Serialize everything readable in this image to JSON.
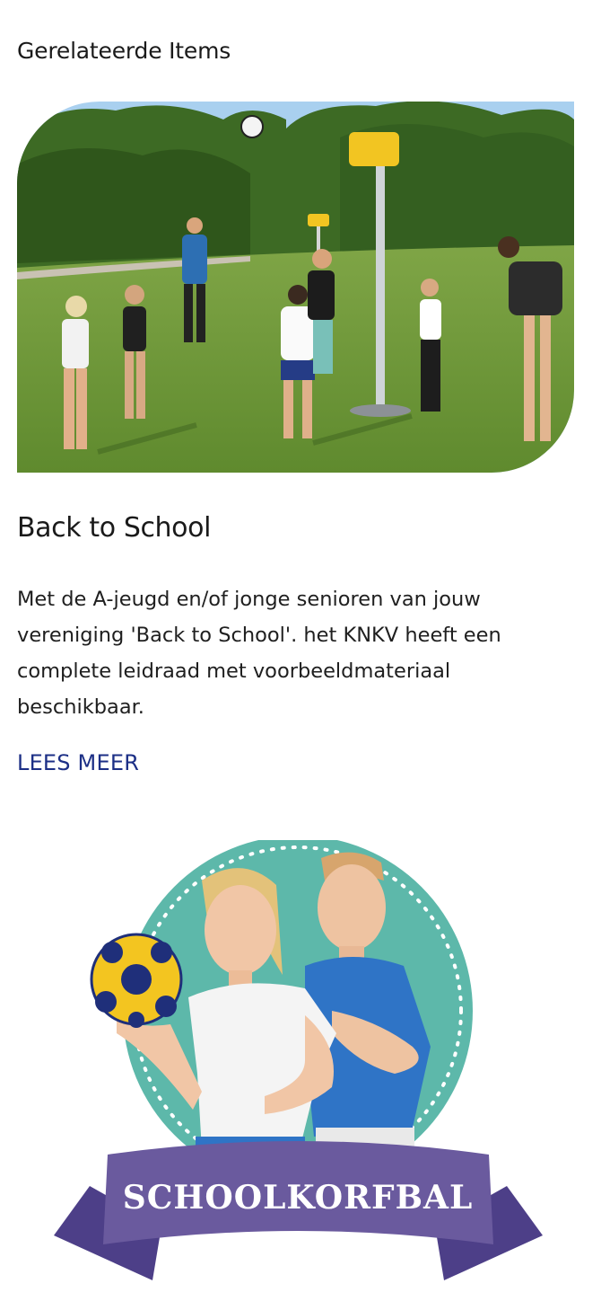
{
  "section": {
    "title": "Gerelateerde Items"
  },
  "card": {
    "title": "Back to School",
    "description": "Met de A-jeugd en/of jonge senioren van jouw vereniging 'Back to School'. het KNKV heeft een complete leidraad met voorbeeldmateriaal beschikbaar.",
    "link_label": "LEES MEER"
  },
  "promo": {
    "banner_text": "SCHOOLKORFBAL"
  },
  "colors": {
    "link": "#1c2f86",
    "banner_purple": "#6a5a9e",
    "badge_teal": "#5db8aa",
    "shirt_blue": "#2f74c6",
    "ball_yellow": "#f3c520",
    "ball_navy": "#1f2f7a"
  }
}
